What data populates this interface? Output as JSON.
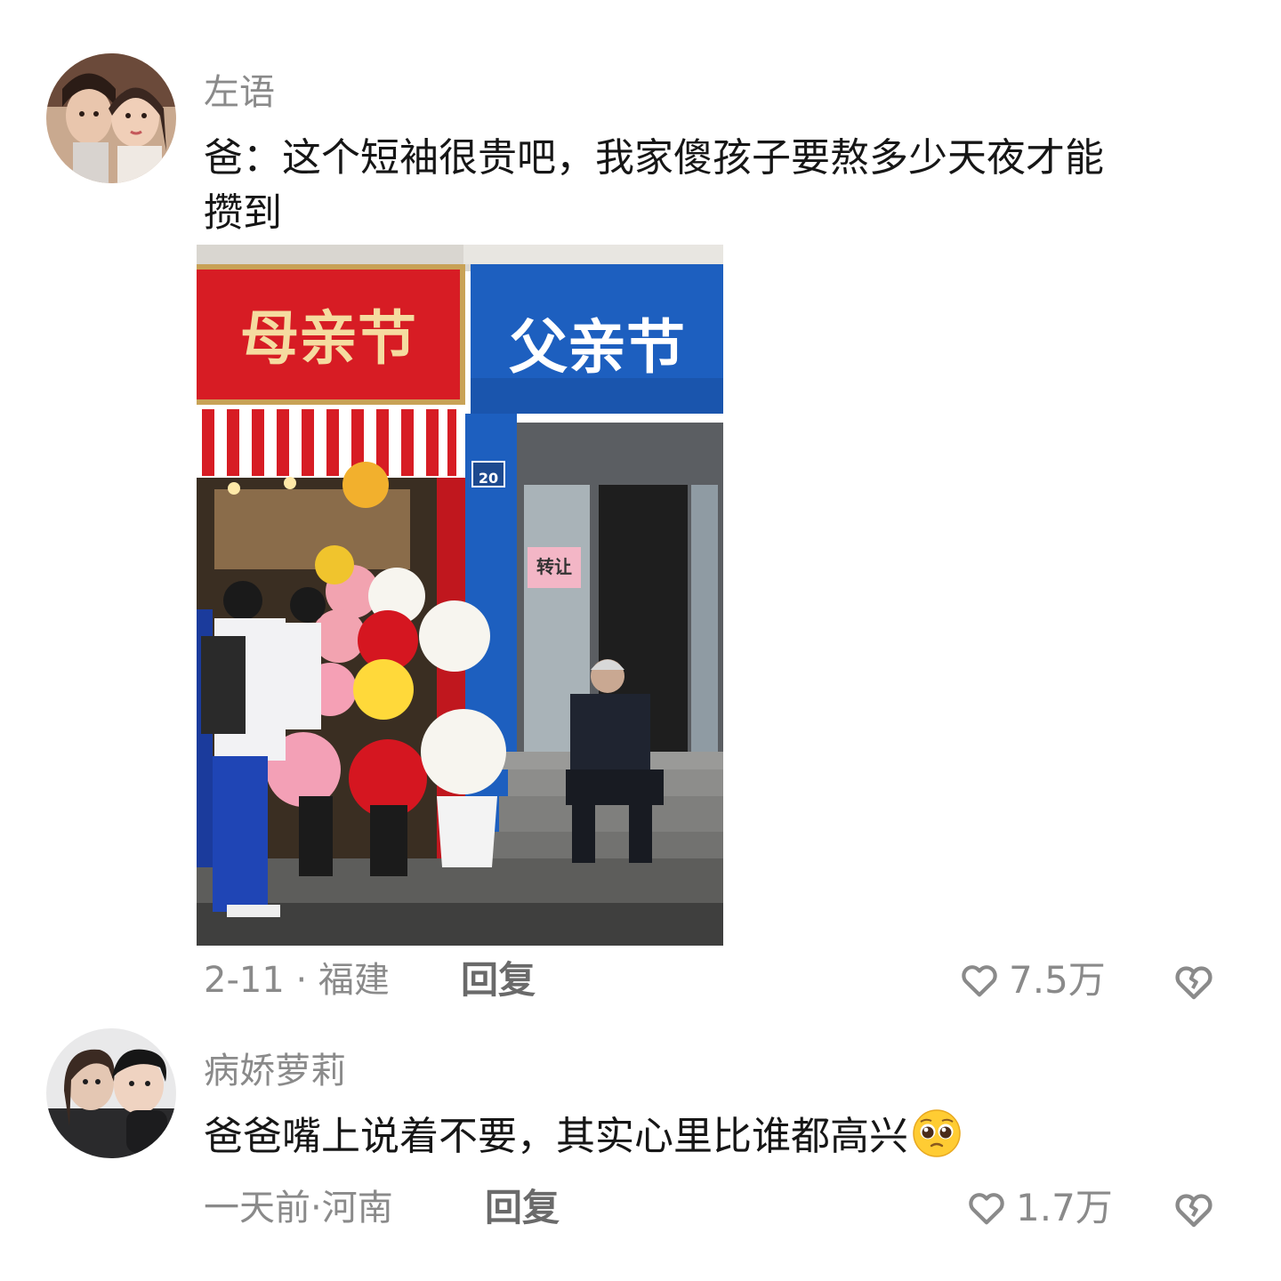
{
  "comments": [
    {
      "username": "左语",
      "text_line1": "爸：这个短袖很贵吧，我家傻孩子要熬多少天夜才能",
      "text_line2": "攒到",
      "image": {
        "sign_left": "母亲节",
        "sign_right": "父亲节",
        "door_number": "20",
        "door_notice": "转让"
      },
      "meta": "2-11 · 福建",
      "reply_label": "回复",
      "likes": "7.5万"
    },
    {
      "username": "病娇萝莉",
      "text": "爸爸嘴上说着不要，其实心里比谁都高兴",
      "emoji": "pleading-face-emoji",
      "meta": "一天前·河南",
      "reply_label": "回复",
      "likes": "1.7万"
    }
  ],
  "icons": {
    "like": "heart-outline-icon",
    "dislike": "broken-heart-icon"
  }
}
